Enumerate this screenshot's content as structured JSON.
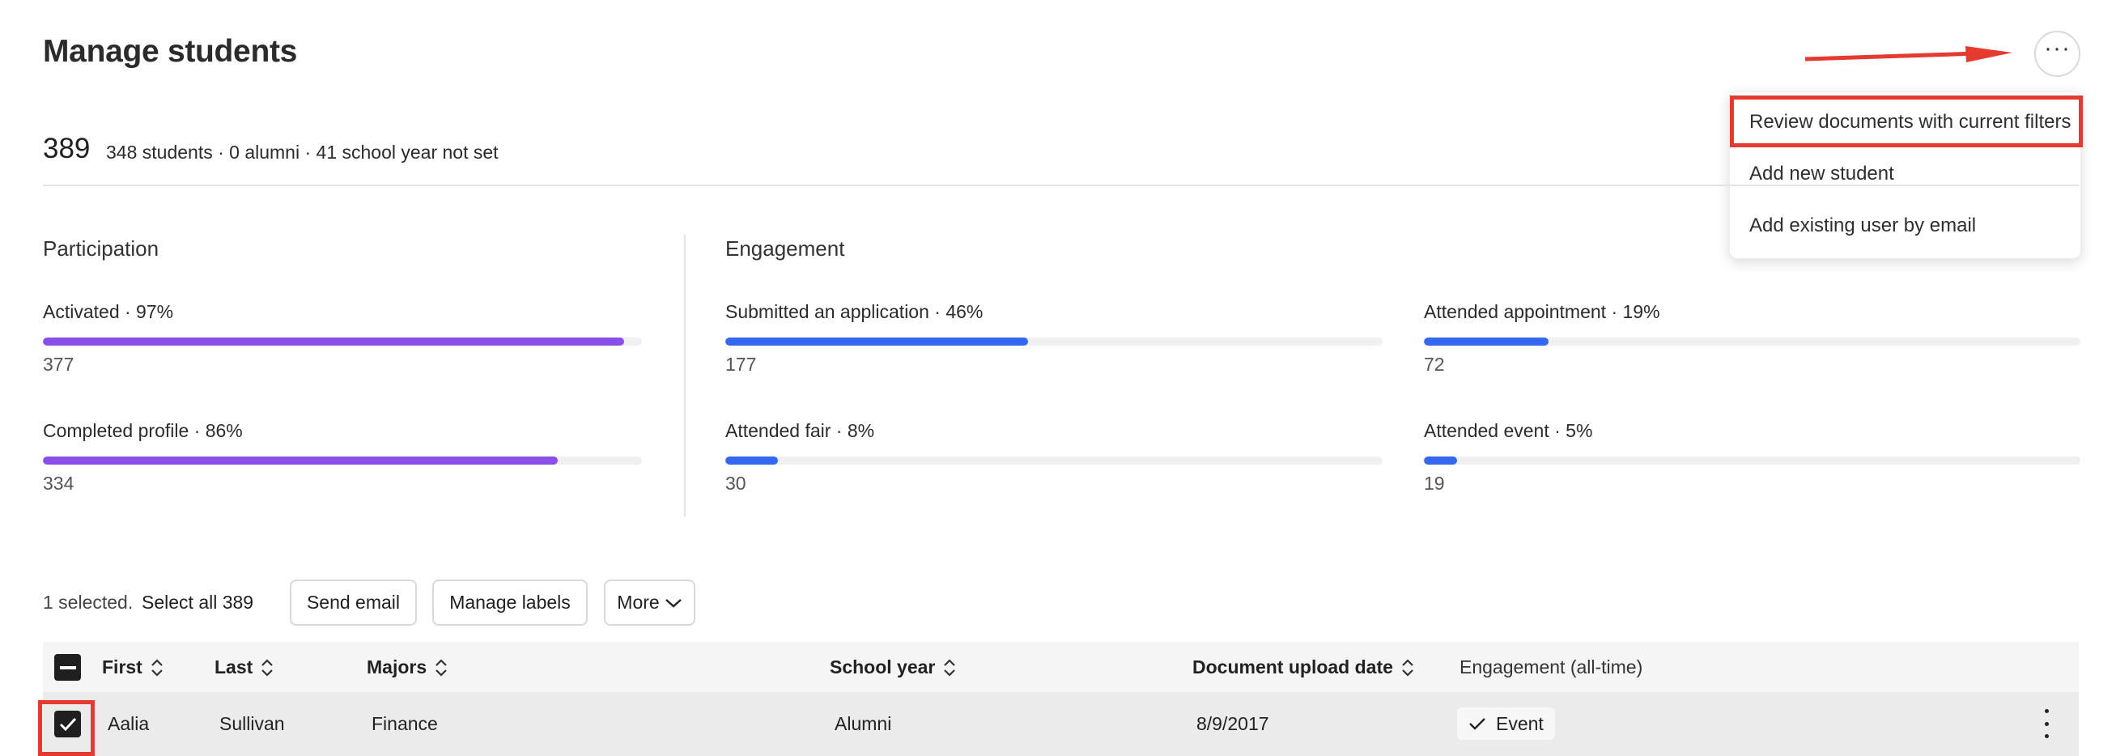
{
  "page": {
    "title": "Manage students"
  },
  "header_menu": {
    "more_label": "···",
    "items": [
      {
        "label": "Review documents with current filters"
      },
      {
        "label": "Add new student"
      },
      {
        "label": "Add existing user by email"
      }
    ]
  },
  "summary": {
    "total": "389",
    "breakdown": "348 students · 0 alumni · 41 school year not set"
  },
  "participation": {
    "title": "Participation",
    "metrics": [
      {
        "label": "Activated · 97%",
        "count": "377",
        "fraction": 0.97
      },
      {
        "label": "Completed profile · 86%",
        "count": "334",
        "fraction": 0.86
      }
    ]
  },
  "engagement": {
    "title": "Engagement",
    "metrics": [
      {
        "label": "Submitted an application · 46%",
        "count": "177",
        "fraction": 0.46
      },
      {
        "label": "Attended appointment · 19%",
        "count": "72",
        "fraction": 0.19
      },
      {
        "label": "Attended fair · 8%",
        "count": "30",
        "fraction": 0.08
      },
      {
        "label": "Attended event · 5%",
        "count": "19",
        "fraction": 0.05
      }
    ]
  },
  "selection": {
    "selected_text": "1 selected.",
    "select_all": "Select all 389",
    "send_email": "Send email",
    "manage_labels": "Manage labels",
    "more": "More"
  },
  "table": {
    "columns": [
      "First",
      "Last",
      "Majors",
      "School year",
      "Document upload date",
      "Engagement (all-time)"
    ],
    "rows": [
      {
        "first": "Aalia",
        "last": "Sullivan",
        "majors": "Finance",
        "school_year": "Alumni",
        "upload_date": "8/9/2017",
        "engagement": "Event"
      }
    ]
  },
  "colors": {
    "accent_purple": "#8a4fe8",
    "accent_blue": "#3468f0",
    "annotation_red": "#e43a2f"
  }
}
